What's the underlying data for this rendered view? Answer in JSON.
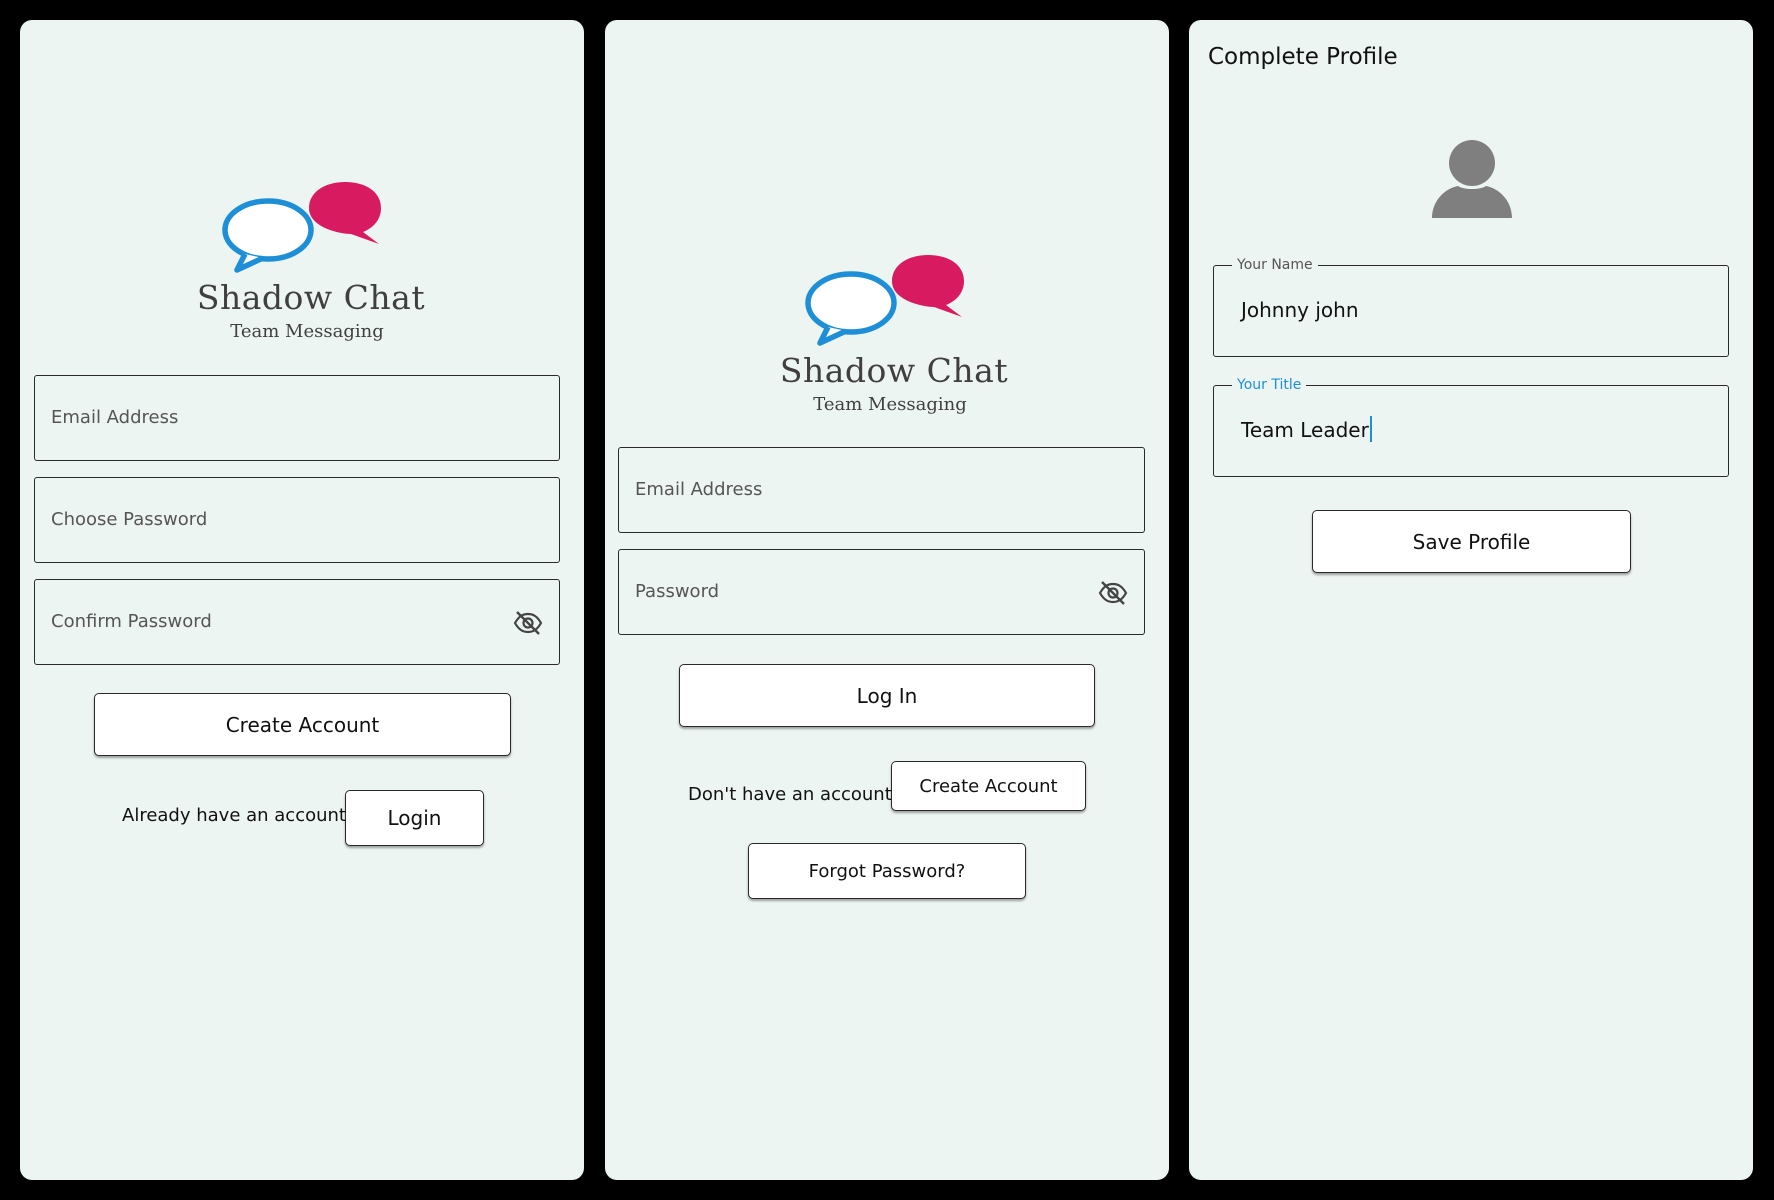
{
  "brand": {
    "name": "Shadow Chat",
    "tagline": "Team Messaging",
    "colors": {
      "bubble_back": "#d81b60",
      "bubble_front": "#1e8fd6"
    }
  },
  "signup_screen": {
    "email_placeholder": "Email Address",
    "password_placeholder": "Choose Password",
    "confirm_placeholder": "Confirm Password",
    "create_label": "Create Account",
    "existing_prompt": "Already have an account?",
    "login_label": "Login"
  },
  "login_screen": {
    "email_placeholder": "Email Address",
    "password_placeholder": "Password",
    "login_label": "Log In",
    "no_account_prompt": "Don't have an account?",
    "create_label": "Create Account",
    "forgot_label": "Forgot Password?"
  },
  "profile_screen": {
    "title": "Complete Profile",
    "name_label": "Your Name",
    "name_value": "Johnny john",
    "title_label": "Your Title",
    "title_value": "Team Leader",
    "save_label": "Save Profile"
  },
  "icons": {
    "eye_off": "eye-off-icon",
    "avatar": "user-avatar-icon"
  },
  "accent_color": "#1e8fd6"
}
